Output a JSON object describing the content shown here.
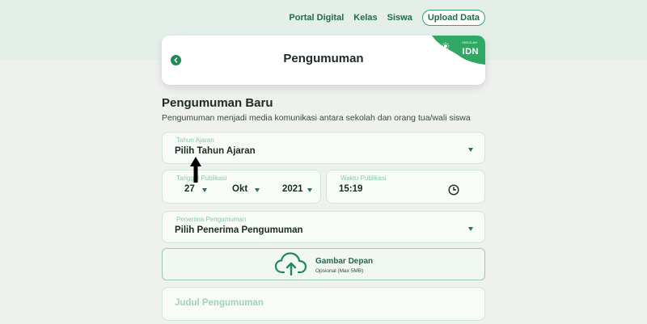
{
  "topnav": {
    "links": [
      "Portal Digital",
      "Kelas",
      "Siswa"
    ],
    "upload_label": "Upload Data"
  },
  "header": {
    "title": "Pengumuman",
    "brand_text": "IDN",
    "brand_small": "SEKOLAH"
  },
  "section": {
    "title": "Pengumuman Baru",
    "description": "Pengumuman menjadi media komunikasi antara sekolah dan orang tua/wali siswa"
  },
  "form": {
    "tahun_ajaran": {
      "label": "Tahun Ajaran",
      "value": "Pilih Tahun Ajaran"
    },
    "tanggal_publikasi": {
      "label": "Tanggal Publikasi",
      "day": "27",
      "month": "Okt",
      "year": "2021"
    },
    "waktu_publikasi": {
      "label": "Waktu Publikasi",
      "value": "15:19"
    },
    "penerima": {
      "label": "Penerima Pengumuman",
      "value": "Pilih Penerima Pengumuman"
    },
    "gambar": {
      "title": "Gambar Depan",
      "subtitle": "Opsional (Max 5MB)"
    },
    "judul": {
      "placeholder": "Judul Pengumuman"
    }
  },
  "colors": {
    "accent": "#1f8a56",
    "brand_green": "#2fa866",
    "page_bg": "#eef1ee"
  },
  "icons": {
    "back": "chevron-left-icon",
    "clock": "clock-icon",
    "upload": "cloud-upload-icon",
    "cursor": "arrow-cursor-icon"
  }
}
